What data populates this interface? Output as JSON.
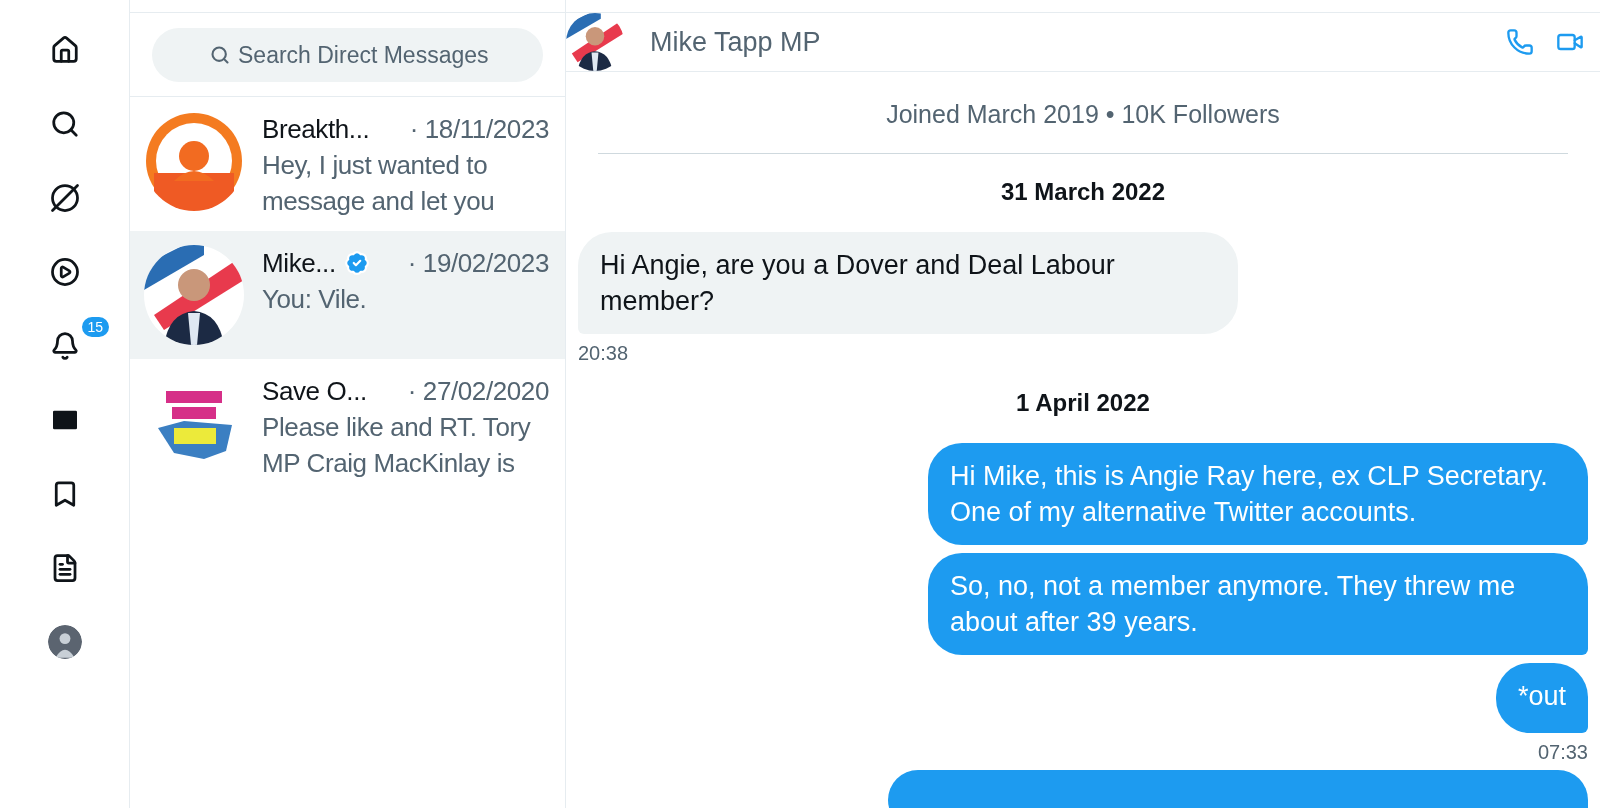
{
  "nav": {
    "items": [
      {
        "kind": "home"
      },
      {
        "kind": "search"
      },
      {
        "kind": "grok"
      },
      {
        "kind": "video"
      },
      {
        "kind": "notifications",
        "badge": "15"
      },
      {
        "kind": "messages",
        "selected": true
      },
      {
        "kind": "bookmarks"
      },
      {
        "kind": "lists"
      },
      {
        "kind": "profile"
      }
    ]
  },
  "search": {
    "placeholder": "Search Direct Messages"
  },
  "conversations": [
    {
      "name": "Breakth...",
      "verified": false,
      "date": "· 18/11/2023",
      "preview": "Hey, I just wanted to message and let you",
      "selected": false,
      "avatar": {
        "kind": "sunrise"
      }
    },
    {
      "name": "Mike...",
      "verified": true,
      "date": "· 19/02/2023",
      "preview": "You: Vile.",
      "selected": true,
      "avatar": {
        "kind": "person"
      }
    },
    {
      "name": "Save O...",
      "verified": false,
      "date": "· 27/02/2020",
      "preview": "Please like and RT. Tory MP Craig MacKinlay is",
      "selected": false,
      "avatar": {
        "kind": "logo"
      }
    }
  ],
  "chat": {
    "title": "Mike Tapp MP",
    "profile_info": "Joined March 2019 • 10K Followers",
    "items": [
      {
        "kind": "date",
        "text": "31 March 2022"
      },
      {
        "kind": "received",
        "text": "Hi Angie, are you a Dover and Deal Labour member?"
      },
      {
        "kind": "time_received",
        "text": "20:38"
      },
      {
        "kind": "date",
        "text": "1 April 2022"
      },
      {
        "kind": "sent",
        "text": "Hi Mike, this is Angie Ray here, ex CLP Secretary. One of my alternative Twitter accounts."
      },
      {
        "kind": "sent",
        "text": "So, no, not a member anymore. They threw me about after 39 years."
      },
      {
        "kind": "sent",
        "text": "*out"
      },
      {
        "kind": "time_sent",
        "text": "07:33"
      },
      {
        "kind": "sent_cut"
      }
    ]
  }
}
